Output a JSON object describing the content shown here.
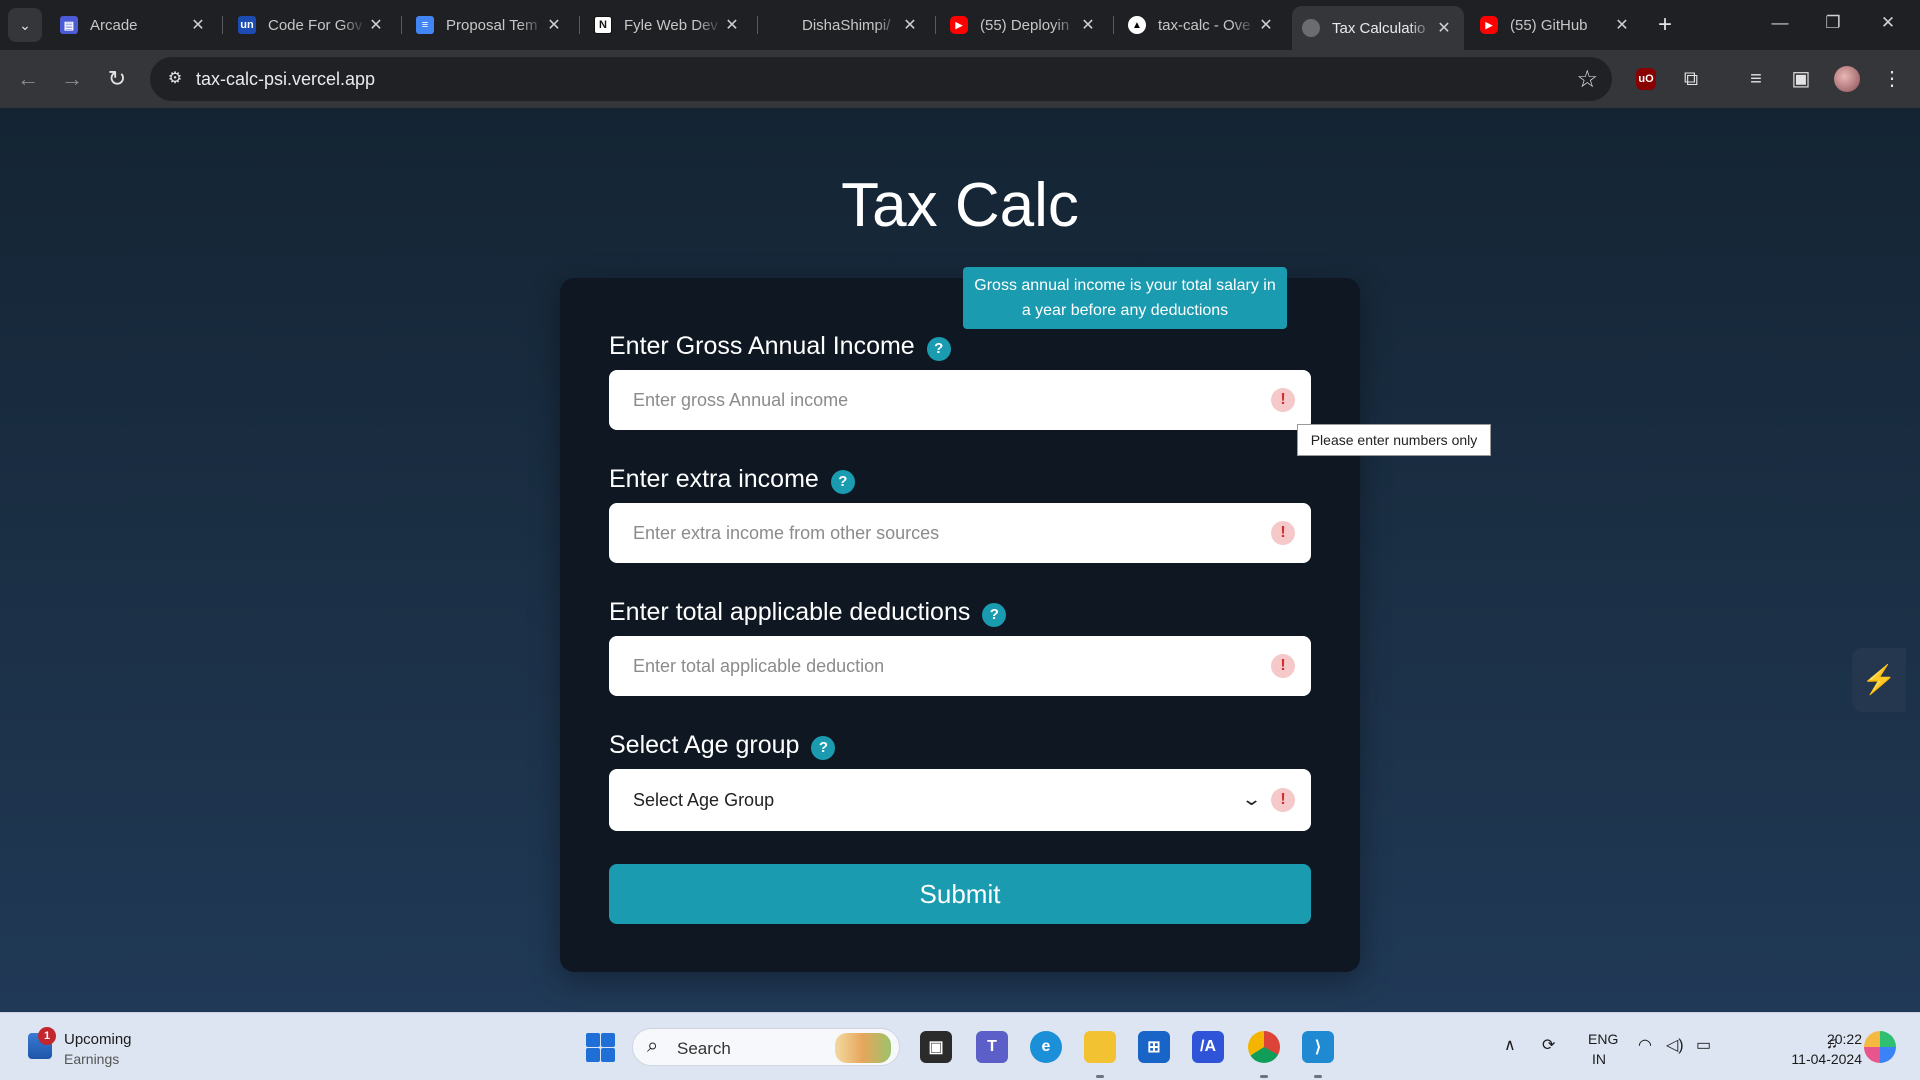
{
  "browser": {
    "tabs": [
      {
        "title": "Arcade",
        "favicon": "arcade-icon",
        "color": "#4b5bd6"
      },
      {
        "title": "Code For Gov",
        "favicon": "unstop-icon",
        "color": "#1c4bb3"
      },
      {
        "title": "Proposal Tem",
        "favicon": "google-docs-icon",
        "color": "#4285f4"
      },
      {
        "title": "Fyle Web Dev",
        "favicon": "notion-icon",
        "color": "#ffffff"
      },
      {
        "title": "DishaShimpi/",
        "favicon": "github-icon",
        "color": "#1f2023"
      },
      {
        "title": "(55) Deployin",
        "favicon": "youtube-icon",
        "color": "#ff0000"
      },
      {
        "title": "tax-calc - Ove",
        "favicon": "vercel-icon",
        "color": "#ffffff"
      },
      {
        "title": "Tax Calculatio",
        "favicon": "globe-icon",
        "color": "#6a6c70"
      },
      {
        "title": "(55) GitHub",
        "favicon": "youtube-icon",
        "color": "#ff0000"
      }
    ],
    "active_tab_index": 7,
    "url": "tax-calc-psi.vercel.app"
  },
  "page": {
    "title": "Tax Calc",
    "fields": [
      {
        "label": "Enter Gross Annual Income",
        "placeholder": "Enter gross Annual income"
      },
      {
        "label": "Enter extra income",
        "placeholder": "Enter extra income from other sources"
      },
      {
        "label": "Enter total applicable deductions",
        "placeholder": "Enter total applicable deduction"
      }
    ],
    "age": {
      "label": "Select Age group",
      "selected": "Select Age Group"
    },
    "submit_label": "Submit",
    "help_glyph": "?",
    "warn_glyph": "!",
    "tooltip_line1": "Gross annual income is your total salary in",
    "tooltip_line2": "a year before any deductions",
    "validation_message": "Please enter numbers only",
    "accent_color": "#1a9bb0"
  },
  "taskbar": {
    "widget_badge": "1",
    "widget_title": "Upcoming",
    "widget_subtitle": "Earnings",
    "search_label": "Search",
    "lang_line1": "ENG",
    "lang_line2": "IN",
    "time": "20:22",
    "date": "11-04-2024"
  }
}
